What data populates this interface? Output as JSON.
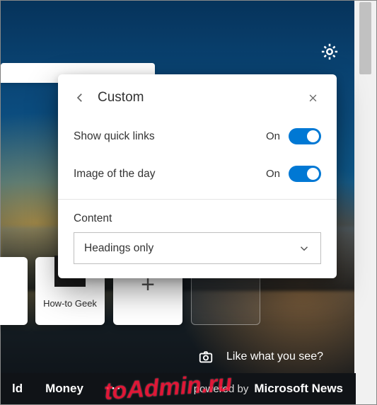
{
  "panel": {
    "title": "Custom",
    "option_quick_links": {
      "label": "Show quick links",
      "state": "On"
    },
    "option_image_day": {
      "label": "Image of the day",
      "state": "On"
    },
    "content_label": "Content",
    "content_value": "Headings only"
  },
  "tiles": {
    "howto_label": "How-to Geek"
  },
  "like_prompt": "Like what you see?",
  "footer": {
    "item_left_partial": "ld",
    "item_money": "Money",
    "more": "···",
    "powered_by": "powered by",
    "brand": "Microsoft News"
  },
  "watermark": "toAdmin.ru"
}
